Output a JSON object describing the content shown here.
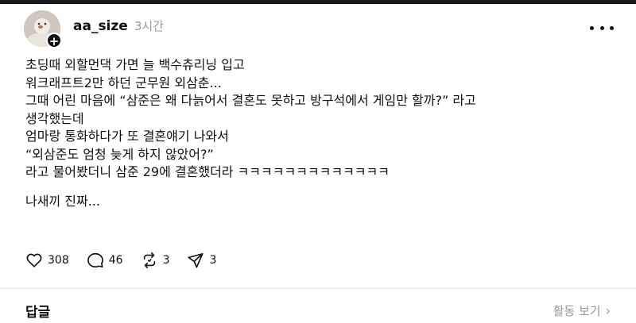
{
  "post": {
    "username": "aa_size",
    "timestamp": "3시간",
    "avatar_badge": "+",
    "body_lines": [
      "초딩때 외할먼댁 가면 늘 백수츄리닝 입고",
      "워크래프트2만 하던 군무원 외삼춘...",
      "그때 어린 마음에 “삼준은 왜 다늙어서 결혼도 못하고 방구석에서 게임만 할까?” 라고",
      "생각했는데",
      "엄마랑 통화하다가 또 결혼얘기 나와서",
      "“외삼준도 엄청 늦게 하지 않았어?”",
      "라고 물어봤더니 삼준 29에 결혼했더라 ㅋㅋㅋㅋㅋㅋㅋㅋㅋㅋㅋㅋㅋ"
    ],
    "closing_line": "나새끼 진짜...",
    "actions": {
      "likes": "308",
      "comments": "46",
      "reposts": "3",
      "shares": "3"
    },
    "icons": {
      "like": "heart-icon",
      "comment": "speech-bubble-icon",
      "repost": "repost-icon",
      "share": "send-icon",
      "more": "more-dots-icon"
    }
  },
  "footer": {
    "replies_label": "답글",
    "activity_label": "활동 보기",
    "activity_chevron": "›"
  }
}
